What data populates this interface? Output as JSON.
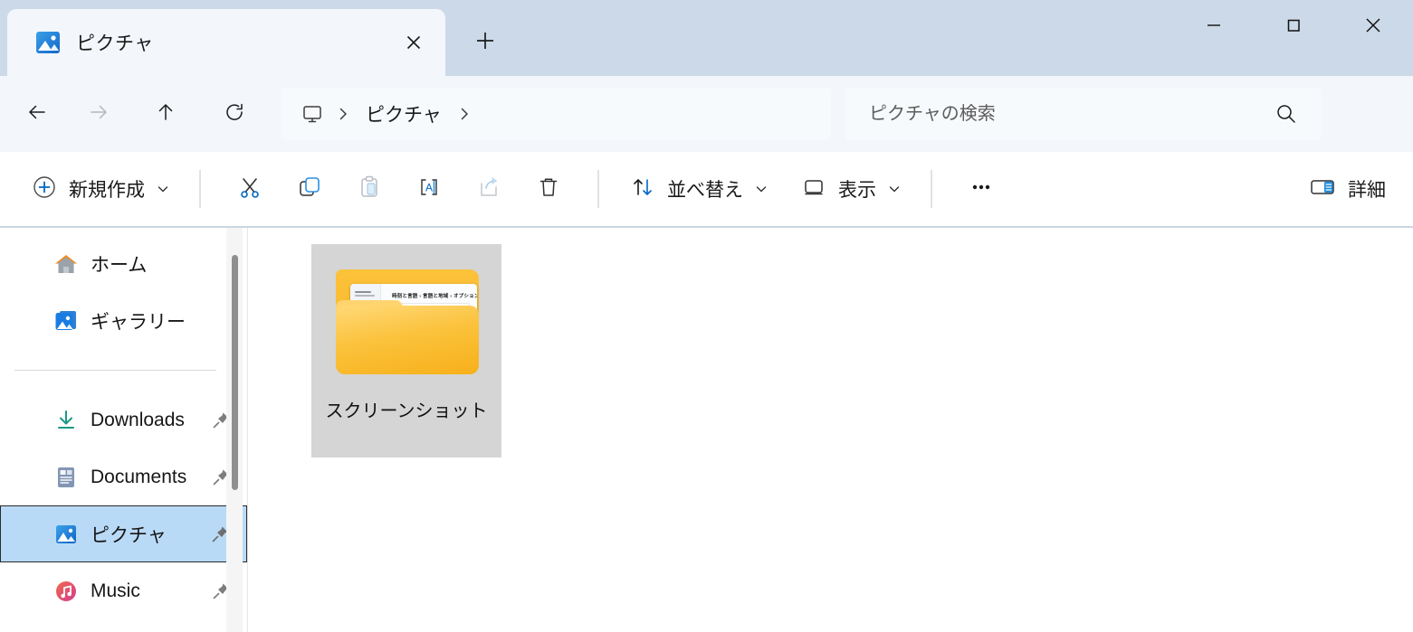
{
  "window": {
    "tab": {
      "title": "ピクチャ",
      "icon": "pictures-icon",
      "close_icon": "close-icon"
    },
    "new_tab_icon": "plus-icon",
    "controls": {
      "minimize": "minimize-icon",
      "maximize": "maximize-icon",
      "close": "close-icon"
    },
    "titlebar_color": "#ccd9e8"
  },
  "navbar": {
    "back": "back-arrow-icon",
    "forward": "forward-arrow-icon",
    "up": "up-arrow-icon",
    "refresh": "refresh-icon",
    "breadcrumb": {
      "root_icon": "monitor-icon",
      "separator": "›",
      "path": "ピクチャ"
    },
    "search": {
      "placeholder": "ピクチャの検索",
      "value": "",
      "icon": "search-icon"
    }
  },
  "toolbar": {
    "new_label": "新規作成",
    "new_icon": "plus-circle-icon",
    "cut_icon": "scissors-icon",
    "copy_icon": "copy-icon",
    "paste_icon": "clipboard-icon",
    "rename_icon": "rename-icon",
    "share_icon": "share-icon",
    "delete_icon": "trash-icon",
    "sort_label": "並べ替え",
    "sort_icon": "sort-arrows-icon",
    "view_label": "表示",
    "view_icon": "view-icon",
    "more_icon": "ellipsis-icon",
    "details_label": "詳細",
    "details_icon": "details-pane-icon",
    "accent_color": "#0067c0"
  },
  "sidebar": {
    "top_items": [
      {
        "label": "ホーム",
        "icon": "home-icon",
        "pinned": false,
        "selected": false
      },
      {
        "label": "ギャラリー",
        "icon": "gallery-icon",
        "pinned": false,
        "selected": false
      }
    ],
    "quick_access": [
      {
        "label": "Downloads",
        "icon": "downloads-icon",
        "pinned": true,
        "selected": false
      },
      {
        "label": "Documents",
        "icon": "documents-icon",
        "pinned": true,
        "selected": false
      },
      {
        "label": "ピクチャ",
        "icon": "pictures-icon",
        "pinned": true,
        "selected": true
      },
      {
        "label": "Music",
        "icon": "music-icon",
        "pinned": true,
        "selected": false
      }
    ],
    "selected_color": "#b9daf6",
    "scrollbar": "vertical-scrollbar"
  },
  "content": {
    "items": [
      {
        "name": "スクリーンショット",
        "type": "folder",
        "selected": true,
        "thumbnail": {
          "kind": "settings-screenshot",
          "breadcrumb": "時刻と言語 › 言語と地域 › オプション"
        }
      }
    ]
  }
}
